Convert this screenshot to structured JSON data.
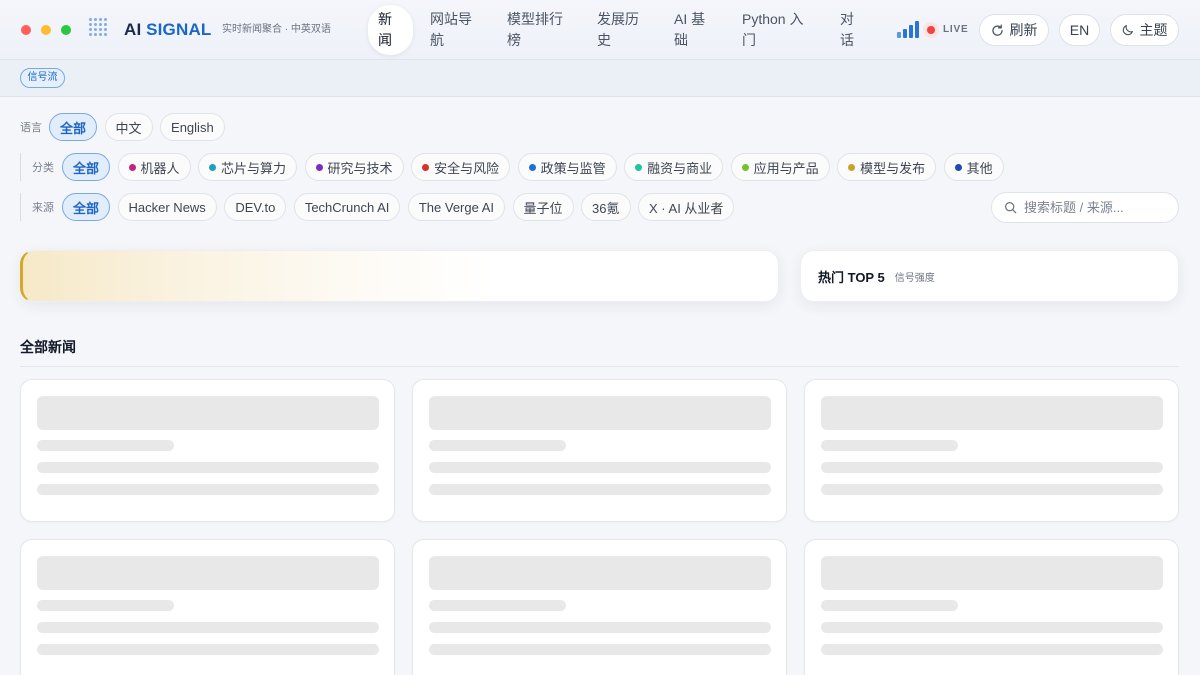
{
  "window_controls": {
    "close": "#ff5f57",
    "minimize": "#febc2e",
    "maximize": "#28c840"
  },
  "brand": {
    "icon": "grid-dots-icon",
    "name_prefix": "AI",
    "name_suffix": "SIGNAL",
    "tagline": "实时新闻聚合 · 中英双语"
  },
  "nav": {
    "items": [
      {
        "label": "新闻",
        "active": true
      },
      {
        "label": "网站导航"
      },
      {
        "label": "模型排行榜"
      },
      {
        "label": "发展历史"
      },
      {
        "label": "AI 基础"
      },
      {
        "label": "Python 入门"
      },
      {
        "label": "对话"
      }
    ]
  },
  "status": {
    "signal_icon": "signal-bars-icon",
    "live_label": "LIVE",
    "live_color": "#ef4444"
  },
  "actions": {
    "refresh": {
      "label": "刷新",
      "icon": "refresh-icon"
    },
    "language": {
      "label": "EN"
    },
    "theme": {
      "label": "主题",
      "icon": "moon-icon"
    }
  },
  "view_badge": {
    "label": "信号流"
  },
  "filters": {
    "language": {
      "label": "语言",
      "options": [
        {
          "label": "全部",
          "active": true
        },
        {
          "label": "中文"
        },
        {
          "label": "English"
        }
      ]
    },
    "category": {
      "label": "分类",
      "options": [
        {
          "label": "全部",
          "active": true
        },
        {
          "label": "机器人",
          "color": "#c2257d"
        },
        {
          "label": "芯片与算力",
          "color": "#17a2c4"
        },
        {
          "label": "研究与技术",
          "color": "#7b2cbf"
        },
        {
          "label": "安全与风险",
          "color": "#d93025"
        },
        {
          "label": "政策与监管",
          "color": "#1f6fd6"
        },
        {
          "label": "融资与商业",
          "color": "#20c4a0"
        },
        {
          "label": "应用与产品",
          "color": "#73c32a"
        },
        {
          "label": "模型与发布",
          "color": "#c9a227"
        },
        {
          "label": "其他",
          "color": "#2447b3"
        }
      ]
    },
    "source": {
      "label": "来源",
      "options": [
        {
          "label": "全部",
          "active": true
        },
        {
          "label": "Hacker News"
        },
        {
          "label": "DEV.to"
        },
        {
          "label": "TechCrunch AI"
        },
        {
          "label": "The Verge AI"
        },
        {
          "label": "量子位"
        },
        {
          "label": "36氪"
        },
        {
          "label": "X · AI 从业者"
        }
      ]
    }
  },
  "search": {
    "placeholder": "搜索标题 / 来源...",
    "icon": "search-icon"
  },
  "hot_panel": {
    "title": "热门 TOP 5",
    "subtitle": "信号强度"
  },
  "news_section": {
    "title": "全部新闻"
  },
  "colors": {
    "accent": "#1a66c9",
    "highlight": "#d6a72a",
    "signal": "#2a74d8"
  }
}
